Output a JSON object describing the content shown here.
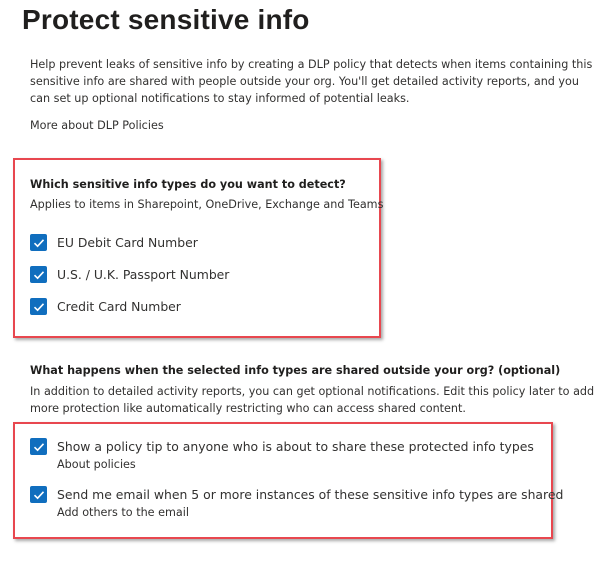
{
  "page": {
    "title": "Protect sensitive info",
    "intro": "Help prevent leaks of sensitive info by creating a DLP policy that detects when items containing this sensitive info are shared with people outside your org. You'll get detailed activity reports, and you can set up optional notifications to stay informed of potential leaks.",
    "more_link": "More about DLP Policies"
  },
  "detect": {
    "heading": "Which sensitive info types do you want to detect?",
    "subtext": "Applies to items in Sharepoint, OneDrive, Exchange and Teams",
    "options": [
      {
        "label": "EU Debit Card Number",
        "checked": true
      },
      {
        "label": "U.S. / U.K. Passport Number",
        "checked": true
      },
      {
        "label": "Credit Card Number",
        "checked": true
      }
    ]
  },
  "notify": {
    "heading": "What happens when the selected info types are shared outside your org? (optional)",
    "subtext": "In addition to detailed activity reports, you can get optional notifications. Edit this policy later to add more protection like automatically restricting who can access shared content.",
    "options": [
      {
        "label": "Show a policy tip to anyone who is about to share these protected info types",
        "sublabel": "About policies",
        "checked": true
      },
      {
        "label": "Send me email when 5 or more instances of these sensitive info types are shared",
        "sublabel": "Add others to the email",
        "checked": true
      }
    ]
  },
  "colors": {
    "checkbox": "#106ebe",
    "highlight_box": "#e8474f"
  },
  "icons": {
    "checkmark": "checkmark-icon"
  }
}
